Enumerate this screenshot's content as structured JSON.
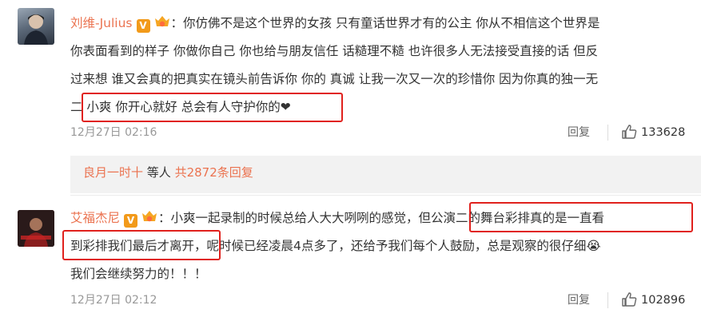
{
  "comments": [
    {
      "username": "刘维-Julius",
      "lines": [
        "：你仿佛不是这个世界的女孩 只有童话世界才有的公主 你从不相信这个世界是",
        "你表面看到的样子 你做你自己 你也给与朋友信任 话糙理不糙 也许很多人无法接受直接的话 但反",
        "过来想 谁又会真的把真实在镜头前告诉你 你的 真诚 让我一次又一次的珍惜你 因为你真的独一无",
        "二 小爽 你开心就好 总会有人守护你的❤"
      ],
      "timestamp": "12月27日 02:16",
      "reply_label": "回复",
      "likes": "133628"
    },
    {
      "username": "艾福杰尼",
      "lines": [
        "：小爽一起录制的时候总给人大大咧咧的感觉，但公演二的舞台彩排真的是一直看",
        "到彩排我们最后才离开，呢时候已经凌晨4点多了，还给予我们每个人鼓励，总是观察的很仔细😭",
        "我们会继续努力的！！！"
      ],
      "timestamp": "12月27日 02:12",
      "reply_label": "回复",
      "likes": "102896"
    }
  ],
  "sub_replies": {
    "user": "良月一时十",
    "middle": " 等人 ",
    "total": "共2872条回复"
  },
  "badges": {
    "v_letter": "V"
  },
  "icons": [
    "verified-v-icon",
    "fan-badge-icon",
    "thumbs-up-icon"
  ],
  "colors": {
    "username": "#eb7350",
    "highlight_border": "#e0211d",
    "muted": "#999999",
    "verified": "#f29a1a"
  }
}
